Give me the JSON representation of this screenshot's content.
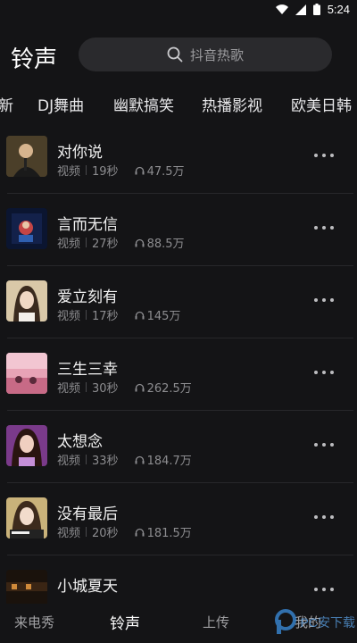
{
  "status_bar": {
    "time": "5:24"
  },
  "header": {
    "title": "铃声",
    "search_placeholder": "抖音热歌"
  },
  "categories": [
    "新",
    "DJ舞曲",
    "幽默搞笑",
    "热播影视",
    "欧美日韩"
  ],
  "songs": [
    {
      "title": "对你说",
      "type": "视频",
      "duration": "19秒",
      "plays": "47.5万"
    },
    {
      "title": "言而无信",
      "type": "视频",
      "duration": "27秒",
      "plays": "88.5万"
    },
    {
      "title": "爱立刻有",
      "type": "视频",
      "duration": "17秒",
      "plays": "145万"
    },
    {
      "title": "三生三幸",
      "type": "视频",
      "duration": "30秒",
      "plays": "262.5万"
    },
    {
      "title": "太想念",
      "type": "视频",
      "duration": "33秒",
      "plays": "184.7万"
    },
    {
      "title": "没有最后",
      "type": "视频",
      "duration": "20秒",
      "plays": "181.5万"
    },
    {
      "title": "小城夏天"
    }
  ],
  "bottom_nav": {
    "tabs": [
      "来电秀",
      "铃声",
      "上传",
      "我的"
    ],
    "active": "铃声"
  },
  "watermark": {
    "text": "PC安下载"
  },
  "colors": {
    "background": "#141416",
    "search_bg": "#2a2a2d",
    "meta": "#8d8d90"
  }
}
